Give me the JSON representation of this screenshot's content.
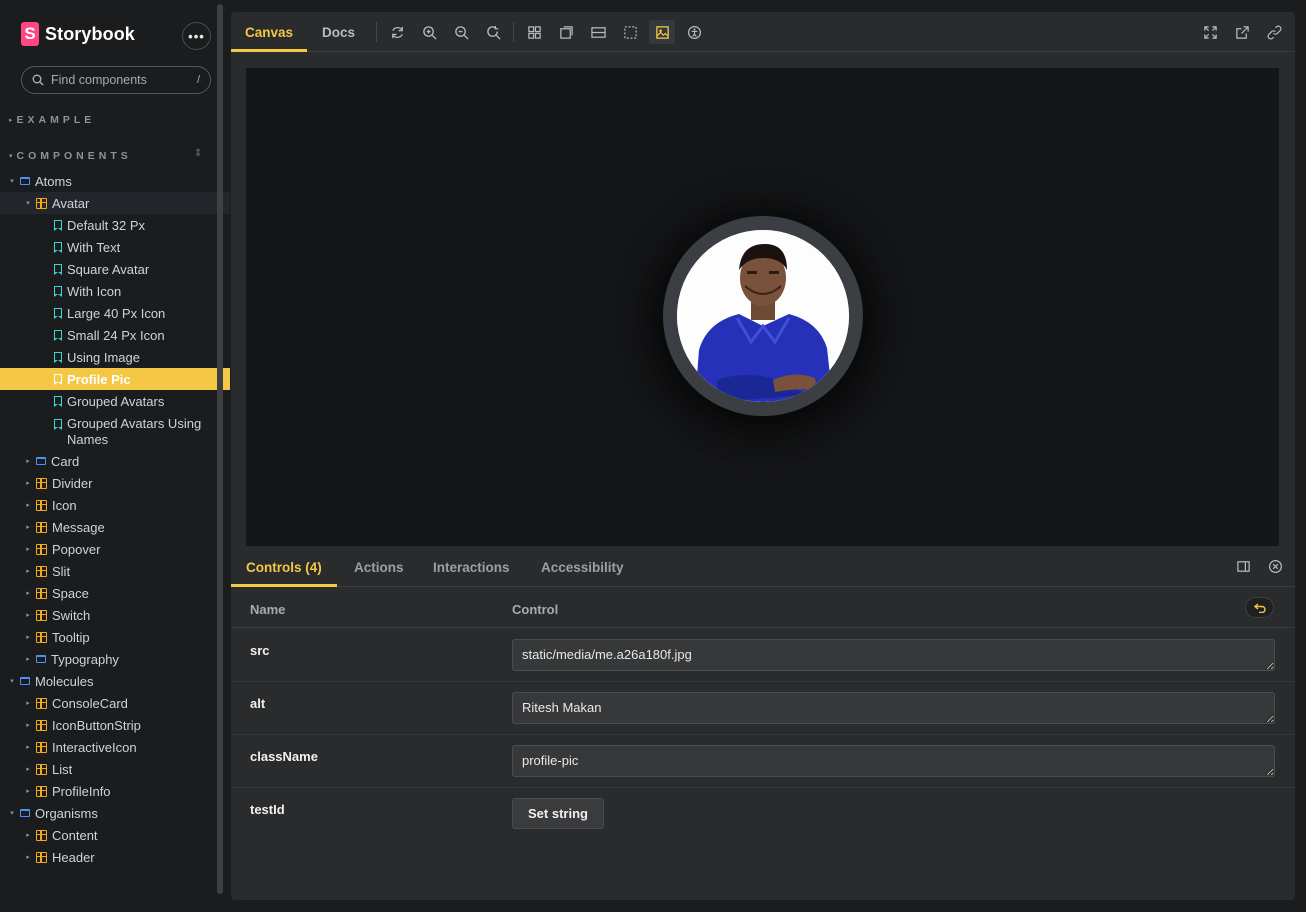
{
  "app": {
    "name": "Storybook",
    "menu_label": "•••"
  },
  "search": {
    "placeholder": "Find components",
    "shortcut": "/"
  },
  "sections": {
    "example": "EXAMPLE",
    "components": "COMPONENTS"
  },
  "tree": [
    {
      "label": "Atoms",
      "kind": "folder",
      "level": 0,
      "expanded": true
    },
    {
      "label": "Avatar",
      "kind": "component",
      "level": 1,
      "expanded": true
    },
    {
      "label": "Default 32 Px",
      "kind": "story",
      "level": 2
    },
    {
      "label": "With Text",
      "kind": "story",
      "level": 2
    },
    {
      "label": "Square Avatar",
      "kind": "story",
      "level": 2
    },
    {
      "label": "With Icon",
      "kind": "story",
      "level": 2
    },
    {
      "label": "Large 40 Px Icon",
      "kind": "story",
      "level": 2
    },
    {
      "label": "Small 24 Px Icon",
      "kind": "story",
      "level": 2
    },
    {
      "label": "Using Image",
      "kind": "story",
      "level": 2
    },
    {
      "label": "Profile Pic",
      "kind": "story",
      "level": 2,
      "selected": true
    },
    {
      "label": "Grouped Avatars",
      "kind": "story",
      "level": 2
    },
    {
      "label": "Grouped Avatars Using Names",
      "kind": "story",
      "level": 2
    },
    {
      "label": "Card",
      "kind": "folder",
      "level": 1
    },
    {
      "label": "Divider",
      "kind": "component",
      "level": 1
    },
    {
      "label": "Icon",
      "kind": "component",
      "level": 1
    },
    {
      "label": "Message",
      "kind": "component",
      "level": 1
    },
    {
      "label": "Popover",
      "kind": "component",
      "level": 1
    },
    {
      "label": "Slit",
      "kind": "component",
      "level": 1
    },
    {
      "label": "Space",
      "kind": "component",
      "level": 1
    },
    {
      "label": "Switch",
      "kind": "component",
      "level": 1
    },
    {
      "label": "Tooltip",
      "kind": "component",
      "level": 1
    },
    {
      "label": "Typography",
      "kind": "folder",
      "level": 1
    },
    {
      "label": "Molecules",
      "kind": "folder",
      "level": 0,
      "expanded": true
    },
    {
      "label": "ConsoleCard",
      "kind": "component",
      "level": 1
    },
    {
      "label": "IconButtonStrip",
      "kind": "component",
      "level": 1
    },
    {
      "label": "InteractiveIcon",
      "kind": "component",
      "level": 1
    },
    {
      "label": "List",
      "kind": "component",
      "level": 1
    },
    {
      "label": "ProfileInfo",
      "kind": "component",
      "level": 1
    },
    {
      "label": "Organisms",
      "kind": "folder",
      "level": 0,
      "expanded": true
    },
    {
      "label": "Content",
      "kind": "component",
      "level": 1
    },
    {
      "label": "Header",
      "kind": "component",
      "level": 1
    }
  ],
  "toolbar": {
    "tabs": [
      "Canvas",
      "Docs"
    ],
    "active_tab": "Canvas",
    "icons": [
      "reload-icon",
      "zoom-in-icon",
      "zoom-out-icon",
      "zoom-reset-icon",
      "grid-icon",
      "background-icon",
      "viewport-icon",
      "outline-icon",
      "image-icon",
      "accessibility-icon"
    ],
    "right_icons": [
      "fullscreen-icon",
      "open-new-tab-icon",
      "copy-link-icon"
    ]
  },
  "addons": {
    "tabs": [
      "Controls (4)",
      "Actions",
      "Interactions",
      "Accessibility"
    ],
    "active_tab": "Controls (4)"
  },
  "controls": {
    "head_name": "Name",
    "head_control": "Control",
    "rows": [
      {
        "name": "src",
        "value": "static/media/me.a26a180f.jpg"
      },
      {
        "name": "alt",
        "value": "Ritesh Makan"
      },
      {
        "name": "className",
        "value": "profile-pic"
      },
      {
        "name": "testId",
        "button": "Set string"
      }
    ]
  },
  "colors": {
    "accent": "#f4c745",
    "story": "#37d5d3",
    "component": "#f4a81a",
    "folder": "#4f8ef6",
    "brand": "#ff4785"
  }
}
